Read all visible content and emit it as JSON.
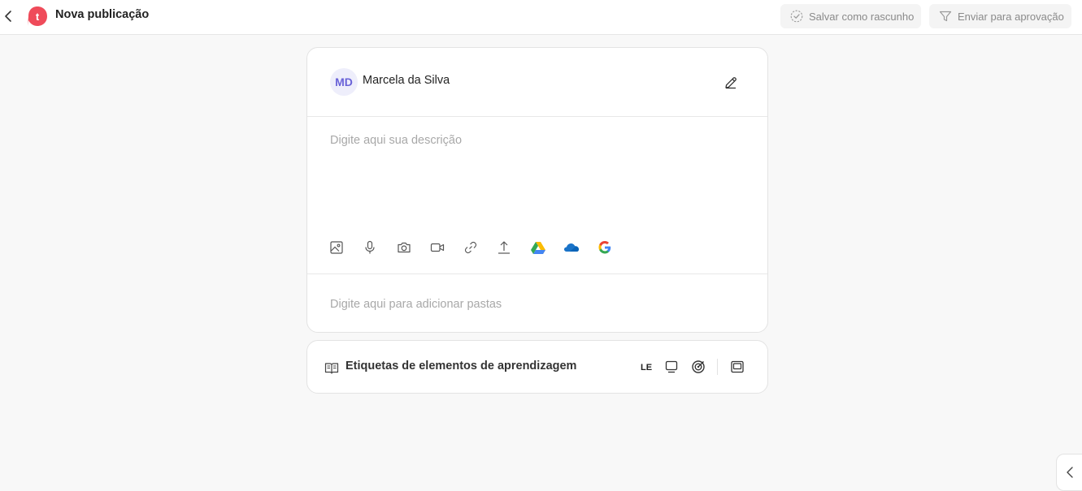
{
  "header": {
    "title": "Nova publicação",
    "logo_letter": "t",
    "save_draft_label": "Salvar como rascunho",
    "submit_label": "Enviar para aprovação"
  },
  "post": {
    "author_initials": "MD",
    "author_name": "Marcela da Silva",
    "description_placeholder": "Digite aqui sua descrição",
    "folders_placeholder": "Digite aqui para adicionar pastas",
    "tools": [
      "image-icon",
      "microphone-icon",
      "camera-icon",
      "video-icon",
      "link-icon",
      "upload-icon",
      "google-drive-icon",
      "onedrive-icon",
      "google-icon"
    ]
  },
  "labels": {
    "title": "Etiquetas de elementos de aprendizagem",
    "le_label": "LE"
  },
  "colors": {
    "brand": "#ef4b5a",
    "avatar_text": "#6a63d8",
    "avatar_bg": "#eeeefb"
  }
}
